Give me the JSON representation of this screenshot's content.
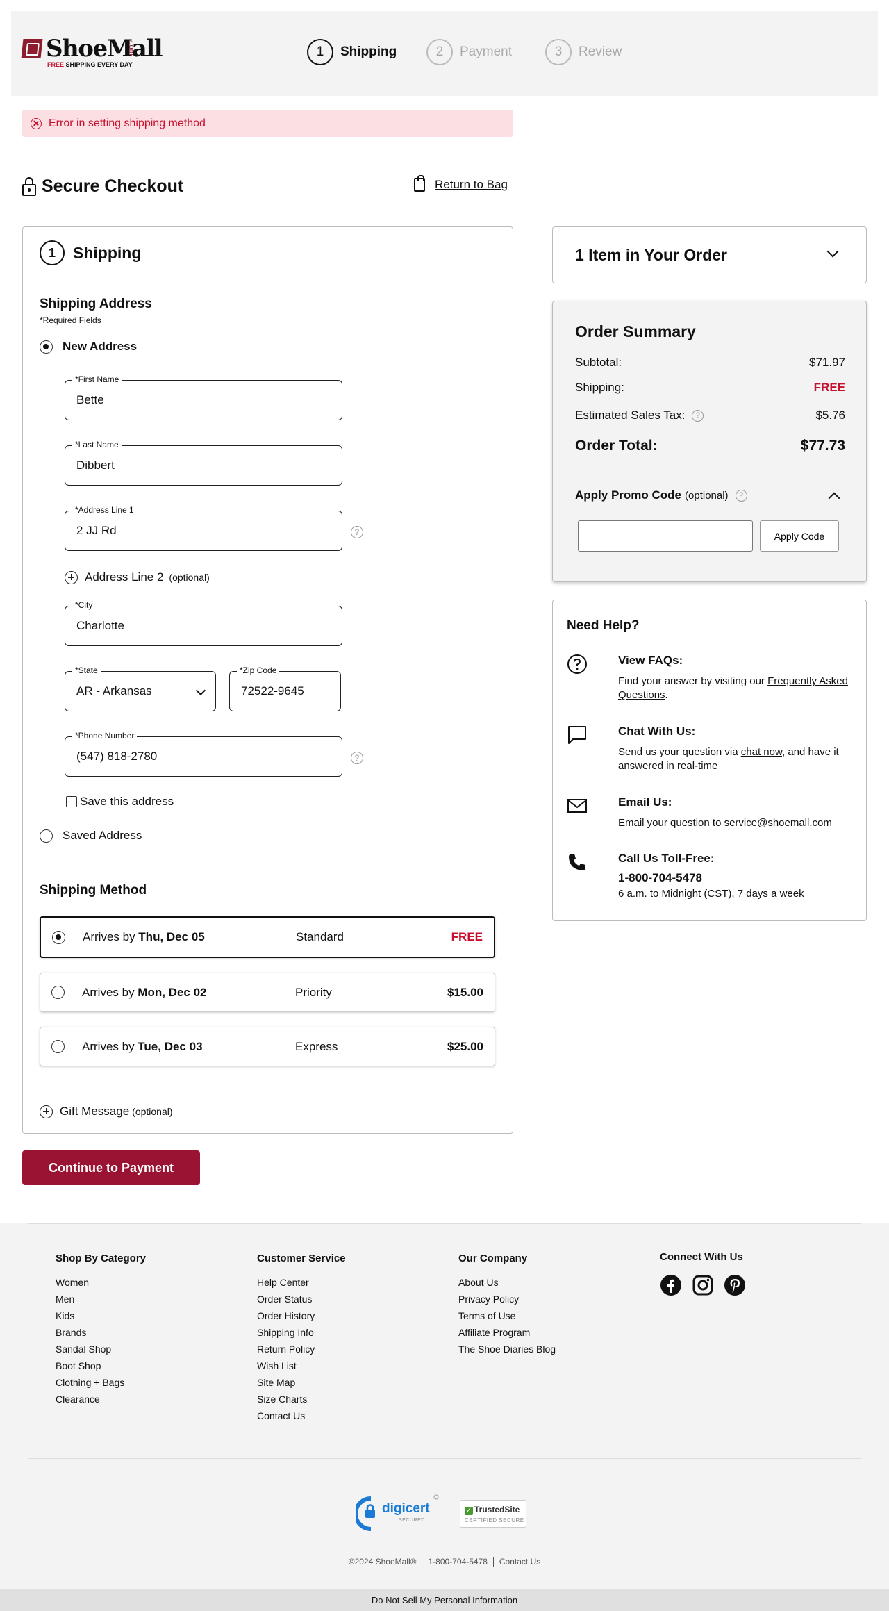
{
  "header": {
    "logo_text": "ShoeMall",
    "logo_com": ".com",
    "logo_tag_free": "FREE",
    "logo_tag_rest": " SHIPPING EVERY DAY",
    "steps": [
      {
        "num": "1",
        "label": "Shipping",
        "active": true
      },
      {
        "num": "2",
        "label": "Payment",
        "active": false
      },
      {
        "num": "3",
        "label": "Review",
        "active": false
      }
    ]
  },
  "error": {
    "message": "Error in setting shipping method"
  },
  "checkout": {
    "title": "Secure Checkout",
    "return_label": "Return to Bag"
  },
  "shipping": {
    "step_num": "1",
    "title": "Shipping",
    "address_title": "Shipping Address",
    "required_note": "*Required Fields",
    "new_address_label": "New Address",
    "saved_address_label": "Saved Address",
    "fields": {
      "first_name": {
        "label": "*First Name",
        "value": "Bette"
      },
      "last_name": {
        "label": "*Last Name",
        "value": "Dibbert"
      },
      "address1": {
        "label": "*Address Line 1",
        "value": "2 JJ Rd"
      },
      "city": {
        "label": "*City",
        "value": "Charlotte"
      },
      "state": {
        "label": "*State",
        "value": "AR - Arkansas"
      },
      "zip": {
        "label": "*Zip Code",
        "value": "72522-9645"
      },
      "phone": {
        "label": "*Phone Number",
        "value": "(547) 818-2780"
      }
    },
    "address2_label": "Address Line 2",
    "address2_optional": "(optional)",
    "save_address_label": "Save this address",
    "method_title": "Shipping Method",
    "methods": [
      {
        "arrives_prefix": "Arrives by ",
        "date": "Thu, Dec 05",
        "type": "Standard",
        "price": "FREE",
        "selected": true
      },
      {
        "arrives_prefix": "Arrives by ",
        "date": "Mon, Dec 02",
        "type": "Priority",
        "price": "$15.00",
        "selected": false
      },
      {
        "arrives_prefix": "Arrives by ",
        "date": "Tue, Dec 03",
        "type": "Express",
        "price": "$25.00",
        "selected": false
      }
    ],
    "gift_label": "Gift Message",
    "gift_optional": "(optional)",
    "continue_label": "Continue to Payment",
    "help_glyph": "?"
  },
  "order": {
    "items_title": "1 Item in Your Order",
    "summary_title": "Order Summary",
    "subtotal_label": "Subtotal:",
    "subtotal_value": "$71.97",
    "shipping_label": "Shipping:",
    "shipping_value": "FREE",
    "tax_label": "Estimated Sales Tax:",
    "tax_value": "$5.76",
    "total_label": "Order Total:",
    "total_value": "$77.73",
    "promo_label": "Apply Promo Code",
    "promo_optional": "(optional)",
    "promo_button": "Apply Code",
    "promo_placeholder": ""
  },
  "help": {
    "title": "Need Help?",
    "faq_title": "View FAQs:",
    "faq_text": "Find your answer by visiting our ",
    "faq_link": "Frequently Asked Questions",
    "faq_end": ".",
    "chat_title": "Chat With Us:",
    "chat_text": "Send us your question via ",
    "chat_link": "chat now",
    "chat_end": ", and have it answered in real-time",
    "email_title": "Email Us:",
    "email_text": "Email your question to ",
    "email_link": "service@shoemall.com",
    "call_title": "Call Us Toll-Free:",
    "call_number": "1-800-704-5478",
    "call_hours": "6 a.m. to Midnight (CST), 7 days a week"
  },
  "footer": {
    "columns": [
      {
        "title": "Shop By Category",
        "items": [
          "Women",
          "Men",
          "Kids",
          "Brands",
          "Sandal Shop",
          "Boot Shop",
          "Clothing + Bags",
          "Clearance"
        ]
      },
      {
        "title": "Customer Service",
        "items": [
          "Help Center",
          "Order Status",
          "Order History",
          "Shipping Info",
          "Return Policy",
          "Wish List",
          "Site Map",
          "Size Charts",
          "Contact Us"
        ]
      },
      {
        "title": "Our Company",
        "items": [
          "About Us",
          "Privacy Policy",
          "Terms of Use",
          "Affiliate Program",
          "The Shoe Diaries Blog"
        ]
      }
    ],
    "connect_title": "Connect With Us",
    "social_icons": [
      "facebook-icon",
      "instagram-icon",
      "pinterest-icon"
    ],
    "digicert_name": "digicert",
    "digicert_sub": "SECURED",
    "trusted_name": "TrustedSite",
    "trusted_sub": "CERTIFIED SECURE",
    "copyright": "©2024 ShoeMall®",
    "phone": "1-800-704-5478",
    "contact": "Contact Us",
    "dnsmpi": "Do Not Sell My Personal Information"
  },
  "colors": {
    "brand": "#9a1333",
    "error": "#c8102e",
    "error_bg": "#fcdfe2",
    "page_bg": "#f3f3f3"
  }
}
